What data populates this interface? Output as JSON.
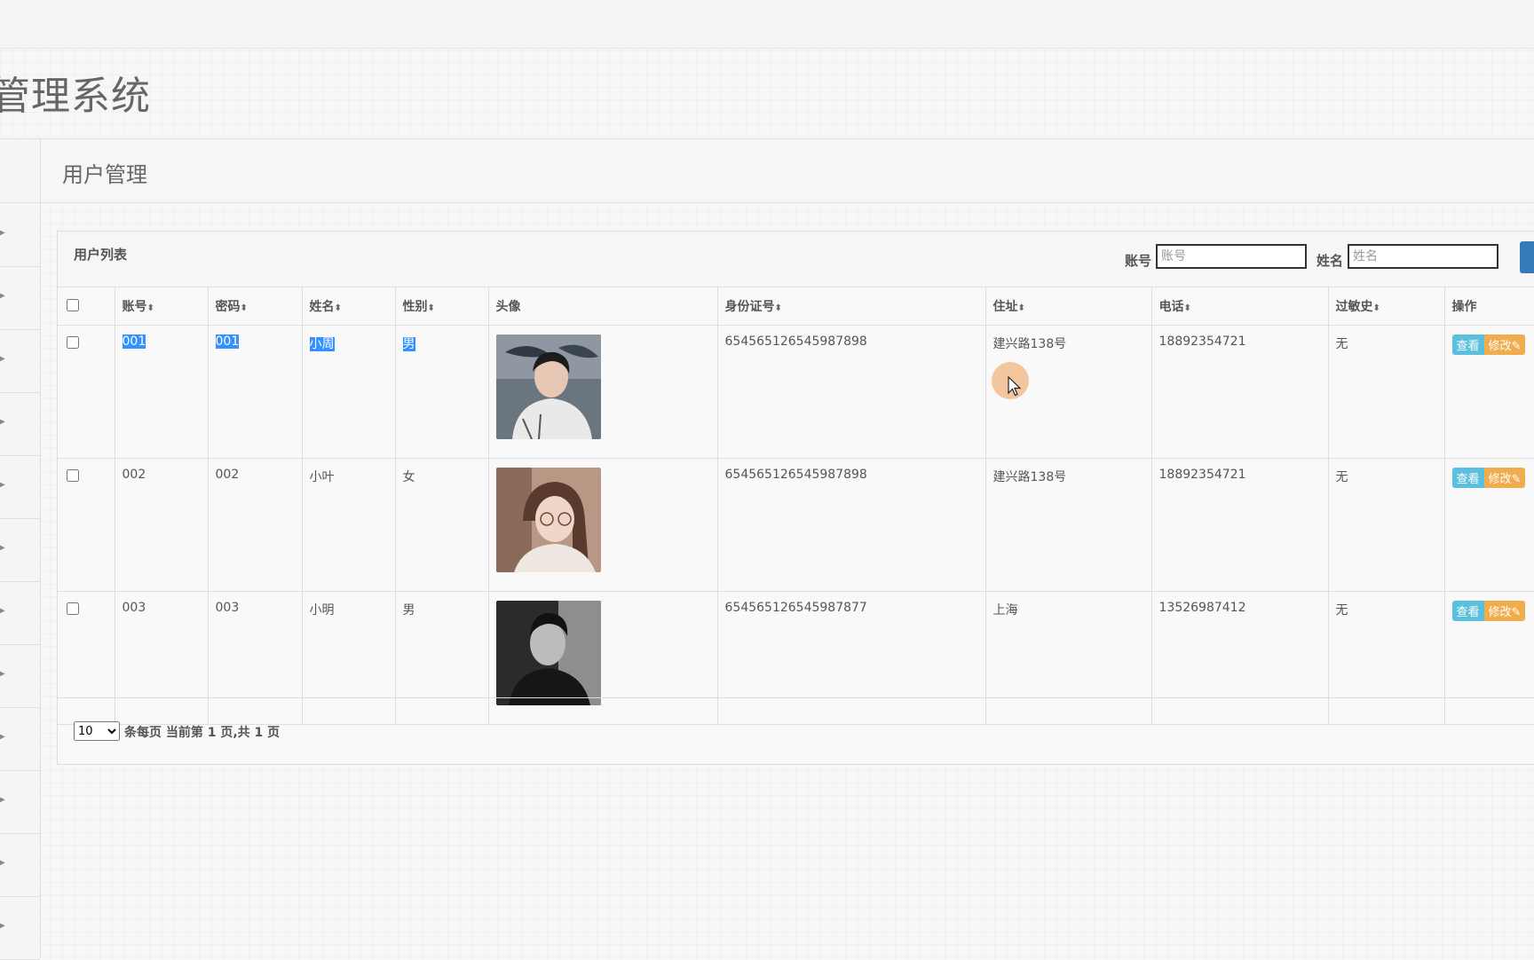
{
  "app": {
    "title": "管理系统"
  },
  "sidebar": {
    "item_count": 13
  },
  "page": {
    "title": "用户管理"
  },
  "panel": {
    "title": "用户列表",
    "search": [
      {
        "label": "账号",
        "placeholder": "账号"
      },
      {
        "label": "姓名",
        "placeholder": "姓名"
      }
    ]
  },
  "table": {
    "columns": [
      "账号",
      "密码",
      "姓名",
      "性别",
      "头像",
      "身份证号",
      "住址",
      "电话",
      "过敏史",
      "操作"
    ],
    "rows": [
      {
        "account": "001",
        "password": "001",
        "name": "小周",
        "gender": "男",
        "avatar": "male-avatar-photo",
        "id_number": "654565126545987898",
        "address": "建兴路138号",
        "phone": "18892354721",
        "allergy": "无"
      },
      {
        "account": "002",
        "password": "002",
        "name": "小叶",
        "gender": "女",
        "avatar": "female-avatar-photo",
        "id_number": "654565126545987898",
        "address": "建兴路138号",
        "phone": "18892354721",
        "allergy": "无"
      },
      {
        "account": "003",
        "password": "003",
        "name": "小明",
        "gender": "男",
        "avatar": "male-avatar-photo-bw",
        "id_number": "654565126545987877",
        "address": "上海",
        "phone": "13526987412",
        "allergy": "无"
      }
    ],
    "actions": {
      "view": "查看",
      "edit": "修改"
    }
  },
  "pager": {
    "page_size": "10",
    "text": "条每页 当前第 1 页,共 1 页"
  },
  "colors": {
    "view_button": "#5bc0de",
    "edit_button": "#f0ad4e",
    "search_button": "#337ab7",
    "selection": "#3390ff"
  }
}
